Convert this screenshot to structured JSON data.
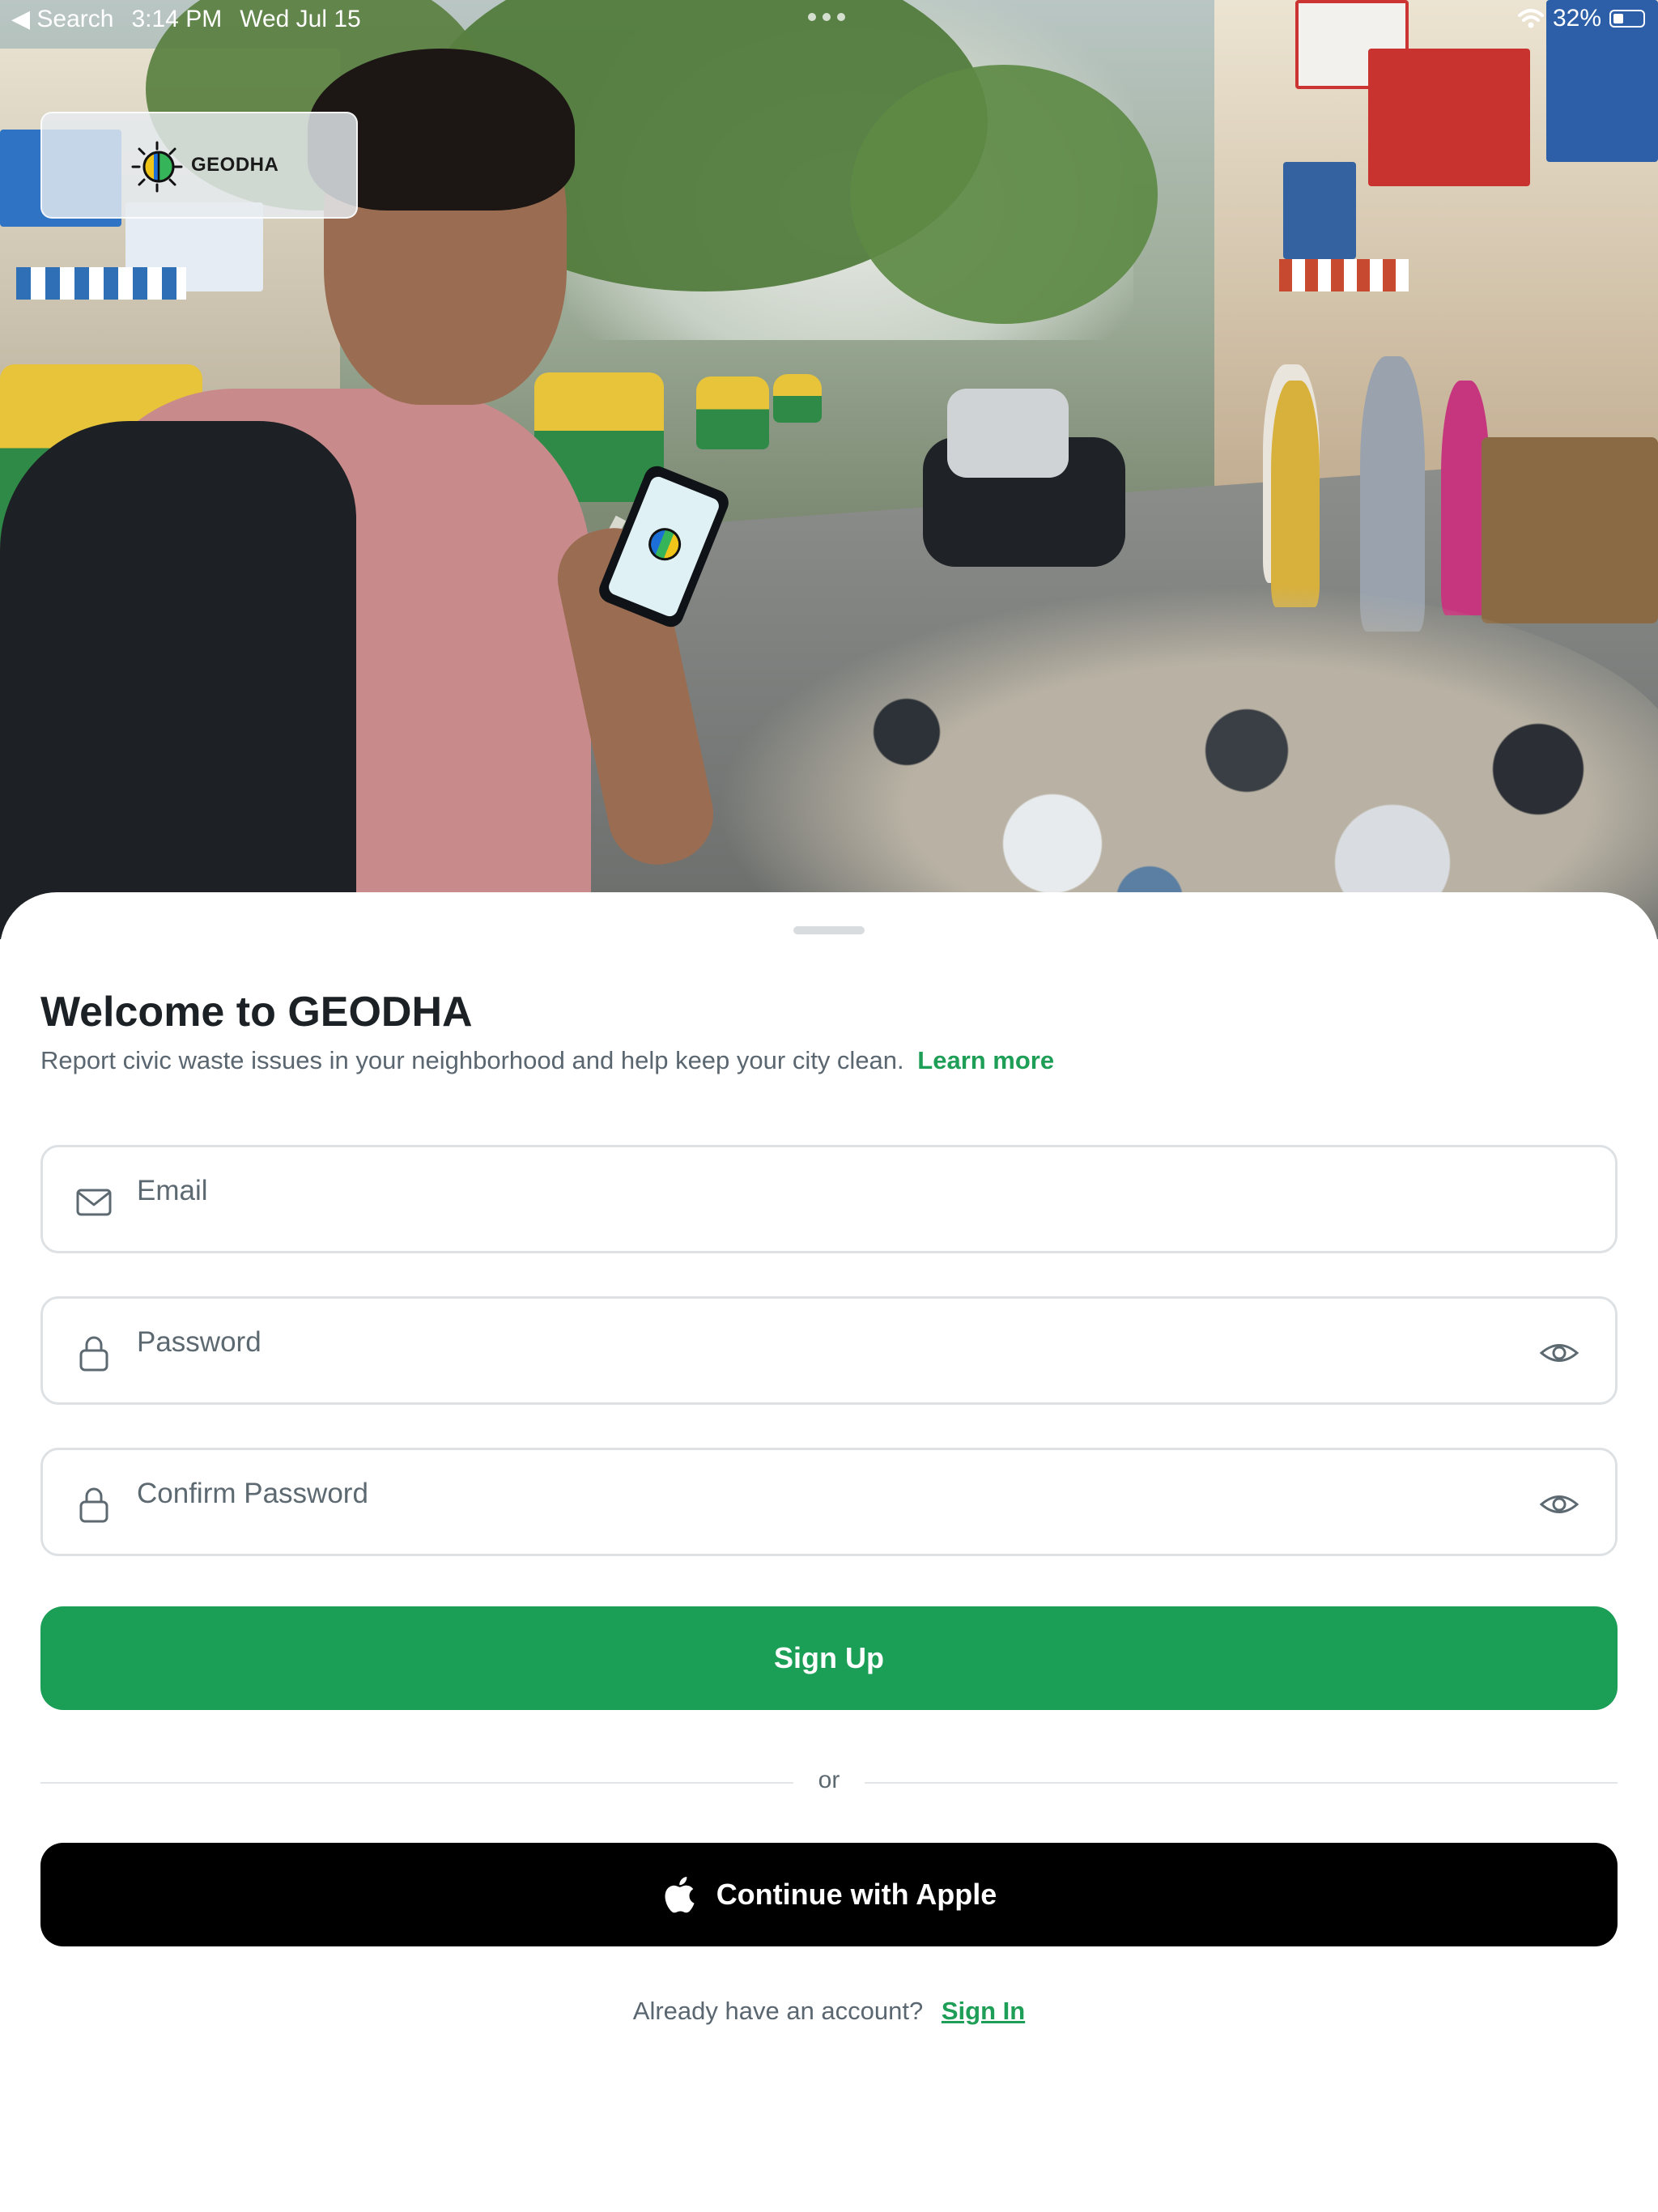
{
  "status_bar": {
    "back_label": "◀ Search",
    "time": "3:14 PM",
    "date": "Wed Jul 15",
    "battery": "32%"
  },
  "logo": {
    "text": "GEODHA",
    "colors": [
      "#1d6fd8",
      "#36b45a",
      "#f0c419"
    ]
  },
  "sheet": {
    "title": "Welcome to GEODHA",
    "subtitle": "Report civic waste issues in your neighborhood and help keep your city clean.",
    "learn_more": "Learn more"
  },
  "form": {
    "email": {
      "placeholder": "Email",
      "value": "",
      "icon": "envelope-icon"
    },
    "password": {
      "placeholder": "Password",
      "value": "",
      "icon": "lock-icon"
    },
    "confirm_password": {
      "placeholder": "Confirm Password",
      "value": "",
      "icon": "lock-icon"
    }
  },
  "buttons": {
    "sign_up": "Sign Up",
    "divider": "or",
    "apple": "Continue with Apple"
  },
  "footer": {
    "prompt": "Already have an account?",
    "sign_in": "Sign In"
  },
  "colors": {
    "accent_green": "#1b9e55",
    "link_green": "#1e9e56",
    "apple_black": "#000000"
  }
}
